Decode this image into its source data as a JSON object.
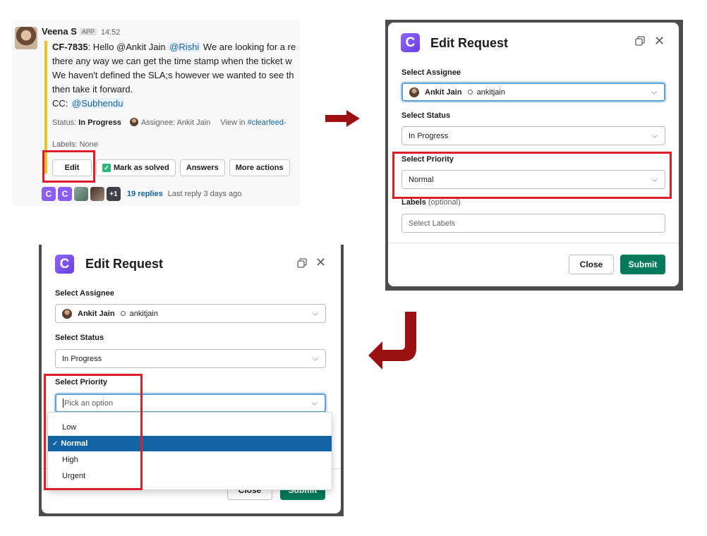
{
  "slack": {
    "sender": "Veena S",
    "app_badge": "APP",
    "time": "14:52",
    "ticket_id": "CF-7835",
    "line1_text": ": Hello @Ankit Jain ",
    "line1_mention": "@Rishi",
    "line1_tail": " We are looking for a re",
    "line2": "there any way we can get the time stamp when the ticket w",
    "line3": "We haven't defined the SLA;s however we wanted to see th",
    "line4": "then take it forward.",
    "cc_label": "CC: ",
    "cc_mention": "@Subhendu",
    "status_label": "Status: ",
    "status_value": "In Progress",
    "assignee_text": "Assignee: Ankit Jain",
    "view_in": "View in ",
    "channel_link": "#clearfeed-",
    "labels_text": "Labels: None",
    "buttons": {
      "edit": "Edit",
      "mark_solved": "Mark as solved",
      "answers": "Answers",
      "more_actions": "More actions"
    },
    "avatar_c1": "C",
    "avatar_c2": "C",
    "avatar_more": "+1",
    "replies": "19 replies",
    "last_reply": "Last reply 3 days ago"
  },
  "modal_top": {
    "logo": "C",
    "title": "Edit Request",
    "assignee_label": "Select Assignee",
    "assignee_name": "Ankit Jain",
    "assignee_handle": "ankitjain",
    "status_label": "Select Status",
    "status_value": "In Progress",
    "priority_label": "Select Priority",
    "priority_value": "Normal",
    "labels_label": "Labels",
    "labels_optional": " (optional)",
    "labels_placeholder": "Select Labels",
    "close_button": "Close",
    "submit_button": "Submit"
  },
  "modal_bottom": {
    "logo": "C",
    "title": "Edit Request",
    "assignee_label": "Select Assignee",
    "assignee_name": "Ankit Jain",
    "assignee_handle": "ankitjain",
    "status_label": "Select Status",
    "status_value": "In Progress",
    "priority_label": "Select Priority",
    "priority_placeholder": "Pick an option",
    "options": [
      "Low",
      "Normal",
      "High",
      "Urgent"
    ],
    "selected_option": "Normal",
    "close_button": "Close",
    "submit_button": "Submit"
  },
  "colors": {
    "highlight": "#dd1e2b",
    "arrow": "#9b1111",
    "submit": "#007a5a",
    "selected": "#1264a3",
    "brand": "#7c4dff"
  },
  "icons": {
    "close": "close-icon",
    "popout": "popout-icon",
    "chevron": "chevron-down-icon",
    "check": "checkmark-icon"
  }
}
